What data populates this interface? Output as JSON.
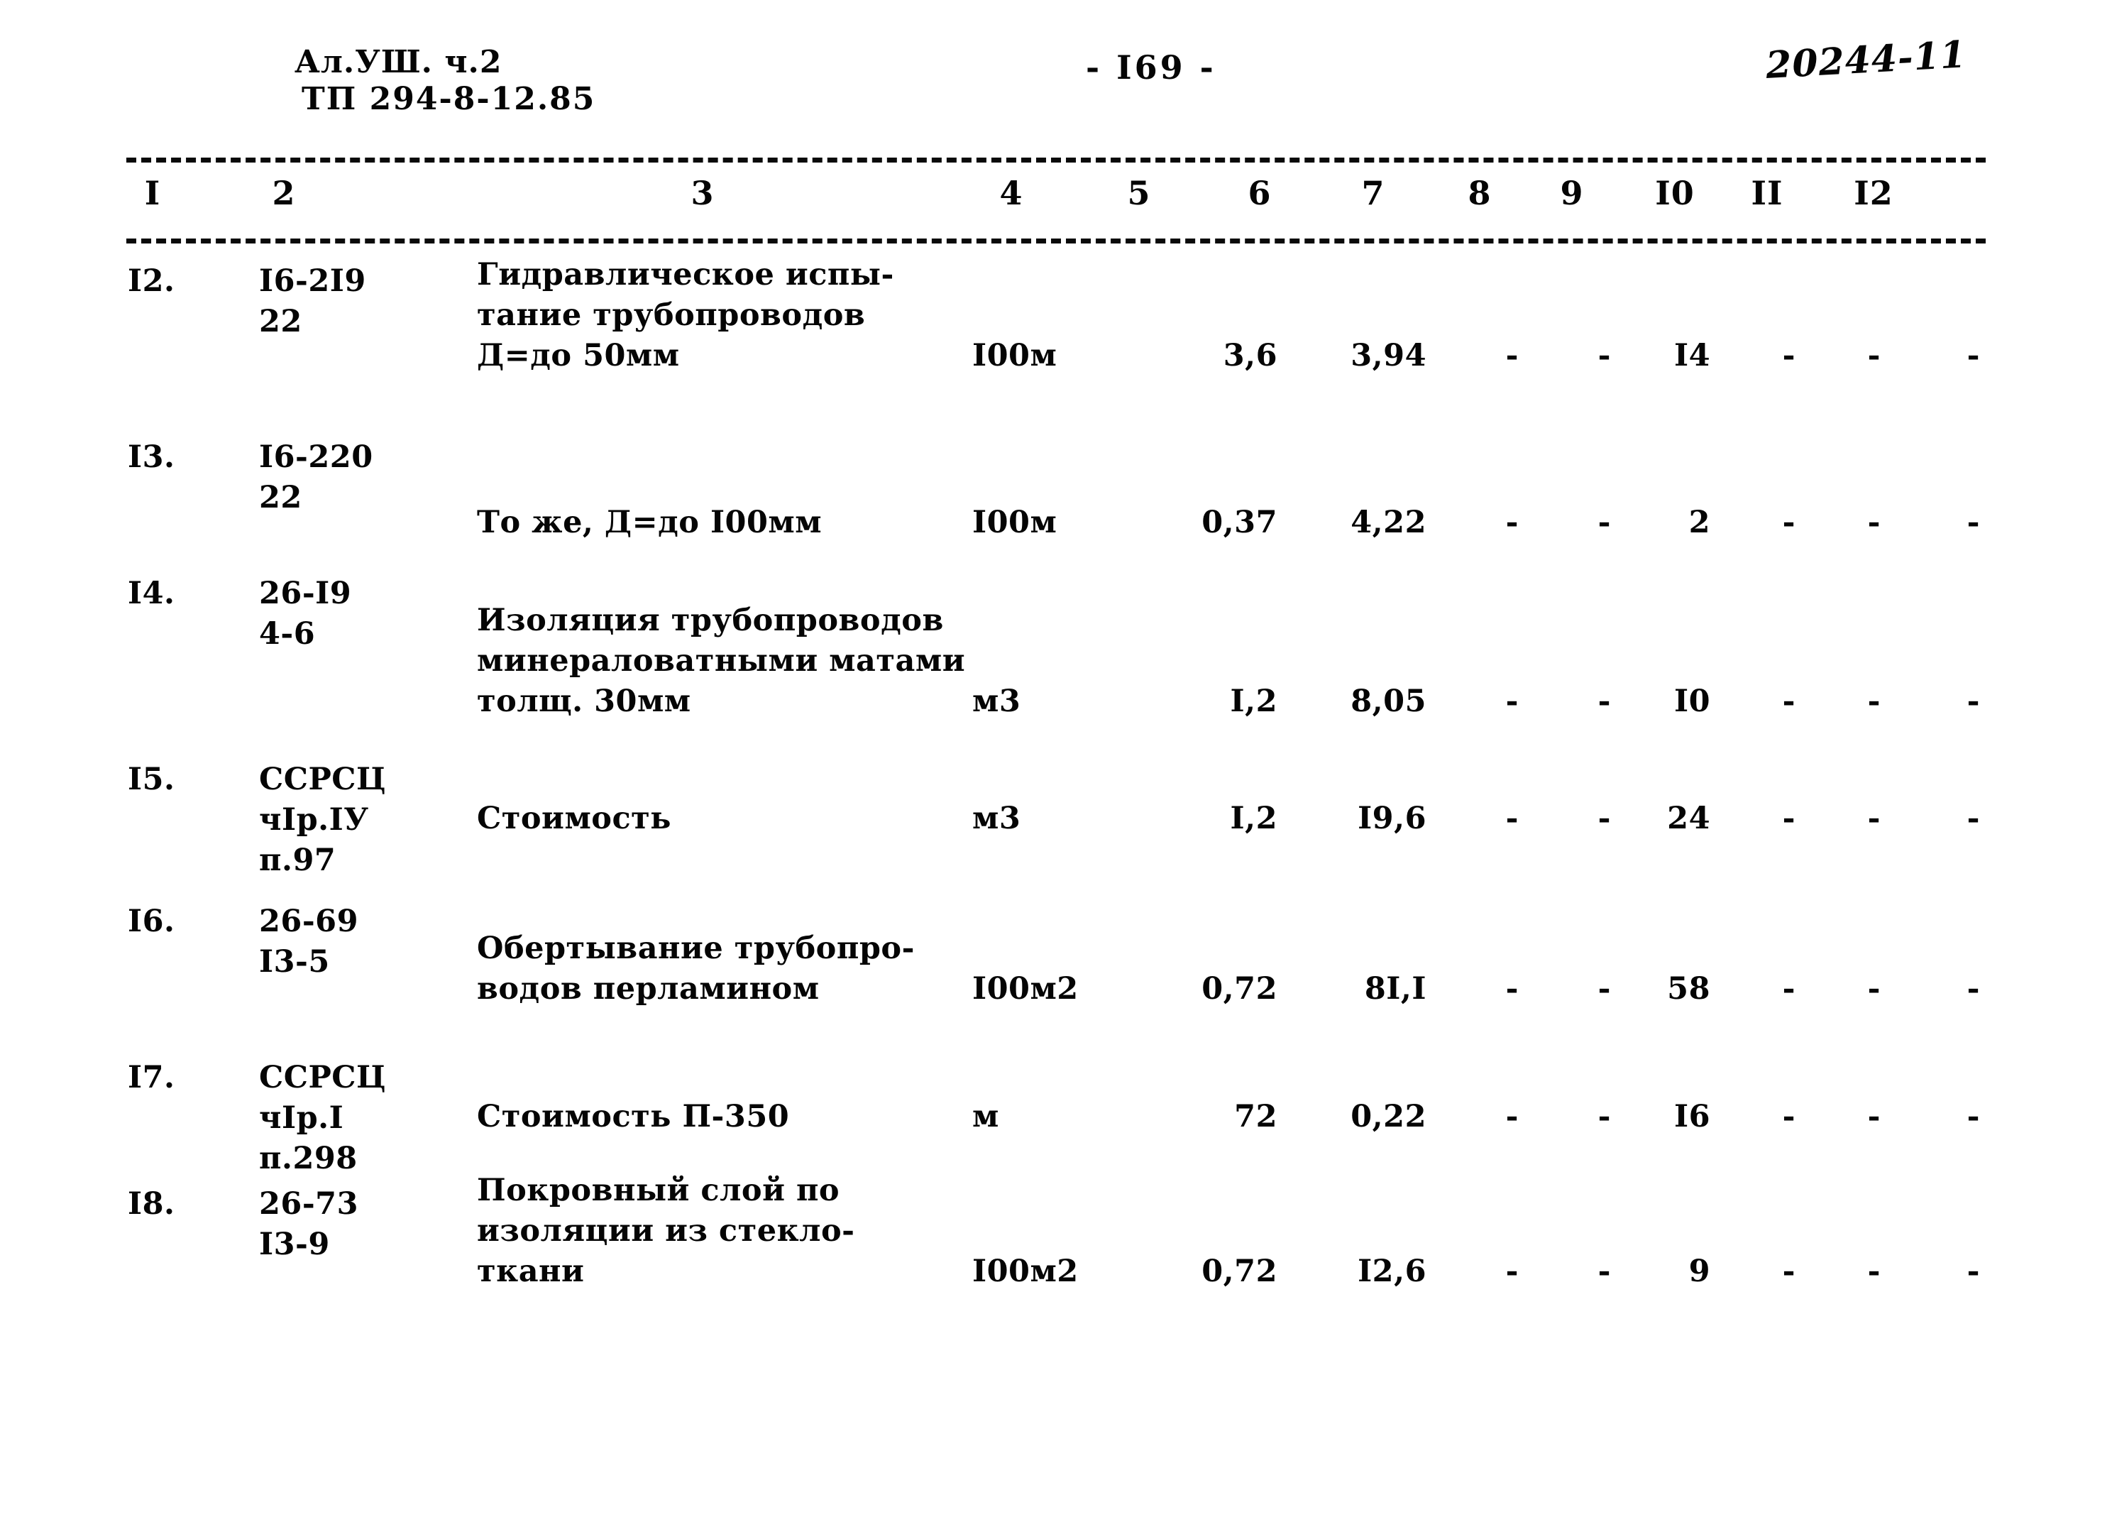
{
  "header": {
    "doc_ref_line1": "Ал.УШ.  ч.2",
    "doc_ref_line2": "ТП  294-8-12.85",
    "page_number": "- I69 -",
    "stamp_number": "20244-11"
  },
  "table": {
    "column_headers": [
      "I",
      "2",
      "3",
      "4",
      "5",
      "6",
      "7",
      "8",
      "9",
      "I0",
      "II",
      "I2"
    ],
    "rows": [
      {
        "no": "I2.",
        "code": "I6-2I9\n22",
        "description": "Гидравлическое испы-\nтание трубопроводов\nД=до 50мм",
        "unit": "I00м",
        "c5": "3,6",
        "c6": "3,94",
        "c7": "-",
        "c8": "-",
        "c9": "I4",
        "c10": "-",
        "c11": "-",
        "c12": "-"
      },
      {
        "no": "I3.",
        "code": "I6-220\n22",
        "description": "То же, Д=до I00мм",
        "unit": "I00м",
        "c5": "0,37",
        "c6": "4,22",
        "c7": "-",
        "c8": "-",
        "c9": "2",
        "c10": "-",
        "c11": "-",
        "c12": "-"
      },
      {
        "no": "I4.",
        "code": "26-I9\n4-6",
        "description": "Изоляция трубопроводов\nминераловатными матами\nтолщ. 30мм",
        "unit": "м3",
        "c5": "I,2",
        "c6": "8,05",
        "c7": "-",
        "c8": "-",
        "c9": "I0",
        "c10": "-",
        "c11": "-",
        "c12": "-"
      },
      {
        "no": "I5.",
        "code": "ССРСЦ\nчIр.IУ\nп.97",
        "description": "Стоимость",
        "unit": "м3",
        "c5": "I,2",
        "c6": "I9,6",
        "c7": "-",
        "c8": "-",
        "c9": "24",
        "c10": "-",
        "c11": "-",
        "c12": "-"
      },
      {
        "no": "I6.",
        "code": "26-69\nI3-5",
        "description": "Обертывание трубопро-\nводов перламином",
        "unit": "I00м2",
        "c5": "0,72",
        "c6": "8I,I",
        "c7": "-",
        "c8": "-",
        "c9": "58",
        "c10": "-",
        "c11": "-",
        "c12": "-"
      },
      {
        "no": "I7.",
        "code": "ССРСЦ\nчIр.I\nп.298",
        "description": "Стоимость П-350",
        "unit": "м",
        "c5": "72",
        "c6": "0,22",
        "c7": "-",
        "c8": "-",
        "c9": "I6",
        "c10": "-",
        "c11": "-",
        "c12": "-"
      },
      {
        "no": "I8.",
        "code": "26-73\nI3-9",
        "description": "Покровный слой по\nизоляции из стекло-\nткани",
        "unit": "I00м2",
        "c5": "0,72",
        "c6": "I2,6",
        "c7": "-",
        "c8": "-",
        "c9": "9",
        "c10": "-",
        "c11": "-",
        "c12": "-"
      }
    ]
  }
}
